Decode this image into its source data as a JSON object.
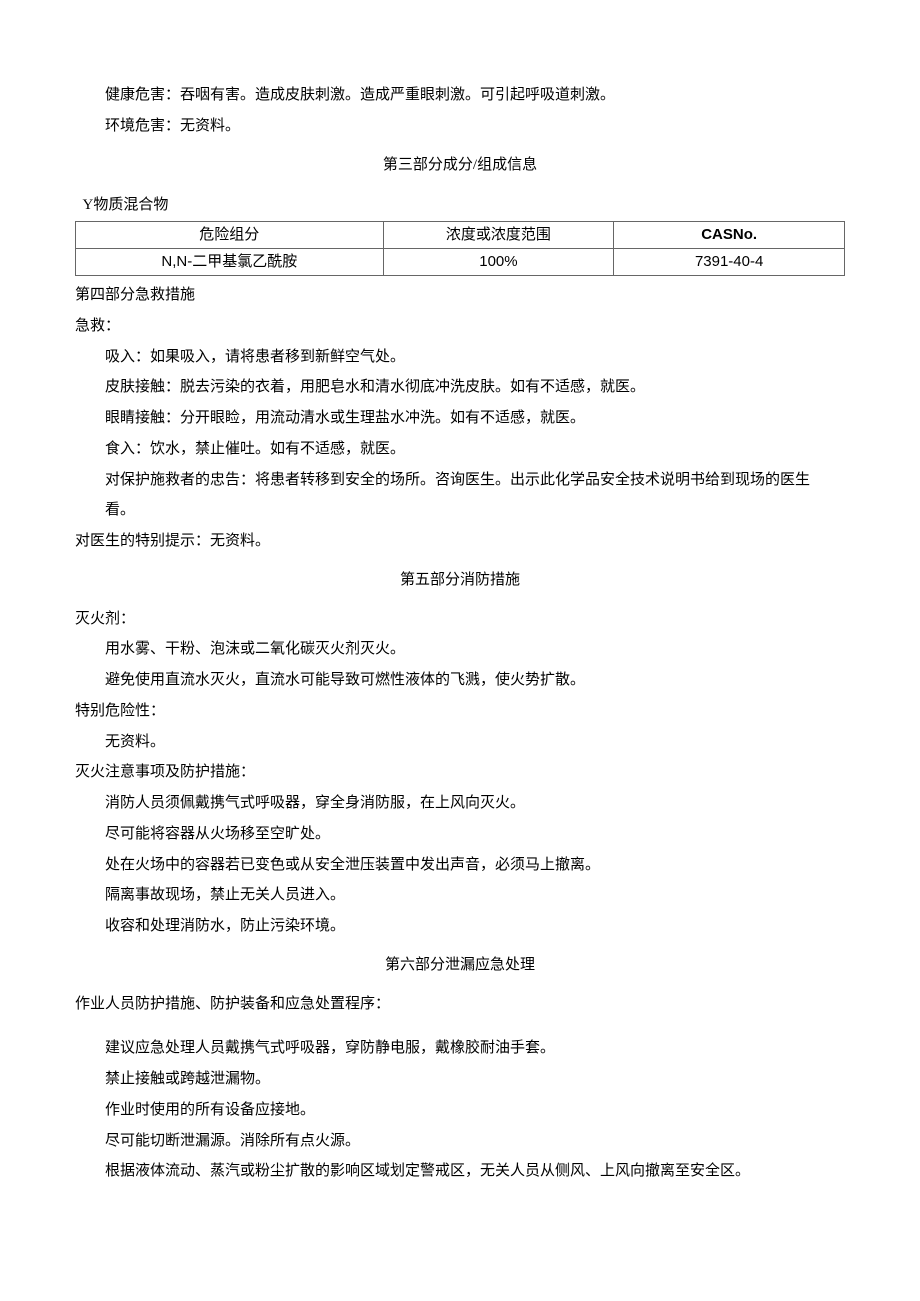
{
  "section2": {
    "health_hazard_label": "健康危害：",
    "health_hazard_text": "吞咽有害。造成皮肤刺激。造成严重眼刺激。可引起呼吸道刺激。",
    "env_hazard_label": "环境危害：",
    "env_hazard_text": "无资料。"
  },
  "section3": {
    "title": "第三部分成分/组成信息",
    "caption": "Y物质混合物",
    "header_col1": "危险组分",
    "header_col2": "浓度或浓度范围",
    "header_col3": "CASNo.",
    "row1_col1": "N,N-二甲基氯乙酰胺",
    "row1_col2": "100%",
    "row1_col3": "7391-40-4"
  },
  "section4": {
    "title": "第四部分急救措施",
    "first_aid_label": "急救：",
    "inhalation": "吸入：如果吸入，请将患者移到新鲜空气处。",
    "skin": "皮肤接触：脱去污染的衣着，用肥皂水和清水彻底冲洗皮肤。如有不适感，就医。",
    "eyes": "眼睛接触：分开眼睑，用流动清水或生理盐水冲洗。如有不适感，就医。",
    "ingestion": "食入：饮水，禁止催吐。如有不适感，就医。",
    "rescuer_line1": "对保护施救者的忠告：将患者转移到安全的场所。咨询医生。出示此化学品安全技术说明书给到现场的医生",
    "rescuer_line2": "看。",
    "doctor_note": "对医生的特别提示：无资料。"
  },
  "section5": {
    "title": "第五部分消防措施",
    "ext_media_label": "灭火剂：",
    "ext_line1": "用水雾、干粉、泡沫或二氧化碳灭火剂灭火。",
    "ext_line2": "避免使用直流水灭火，直流水可能导致可燃性液体的飞溅，使火势扩散。",
    "special_hazard_label": "特别危险性：",
    "special_hazard_text": "无资料。",
    "precautions_label": "灭火注意事项及防护措施：",
    "prec1": "消防人员须佩戴携气式呼吸器，穿全身消防服，在上风向灭火。",
    "prec2": "尽可能将容器从火场移至空旷处。",
    "prec3": "处在火场中的容器若已变色或从安全泄压装置中发出声音，必须马上撤离。",
    "prec4": "隔离事故现场，禁止无关人员进入。",
    "prec5": "收容和处理消防水，防止污染环境。"
  },
  "section6": {
    "title": "第六部分泄漏应急处理",
    "personnel_label": "作业人员防护措施、防护装备和应急处置程序：",
    "line1": "建议应急处理人员戴携气式呼吸器，穿防静电服，戴橡胶耐油手套。",
    "line2": "禁止接触或跨越泄漏物。",
    "line3": "作业时使用的所有设备应接地。",
    "line4": "尽可能切断泄漏源。消除所有点火源。",
    "line5": "根据液体流动、蒸汽或粉尘扩散的影响区域划定警戒区，无关人员从侧风、上风向撤离至安全区。"
  }
}
